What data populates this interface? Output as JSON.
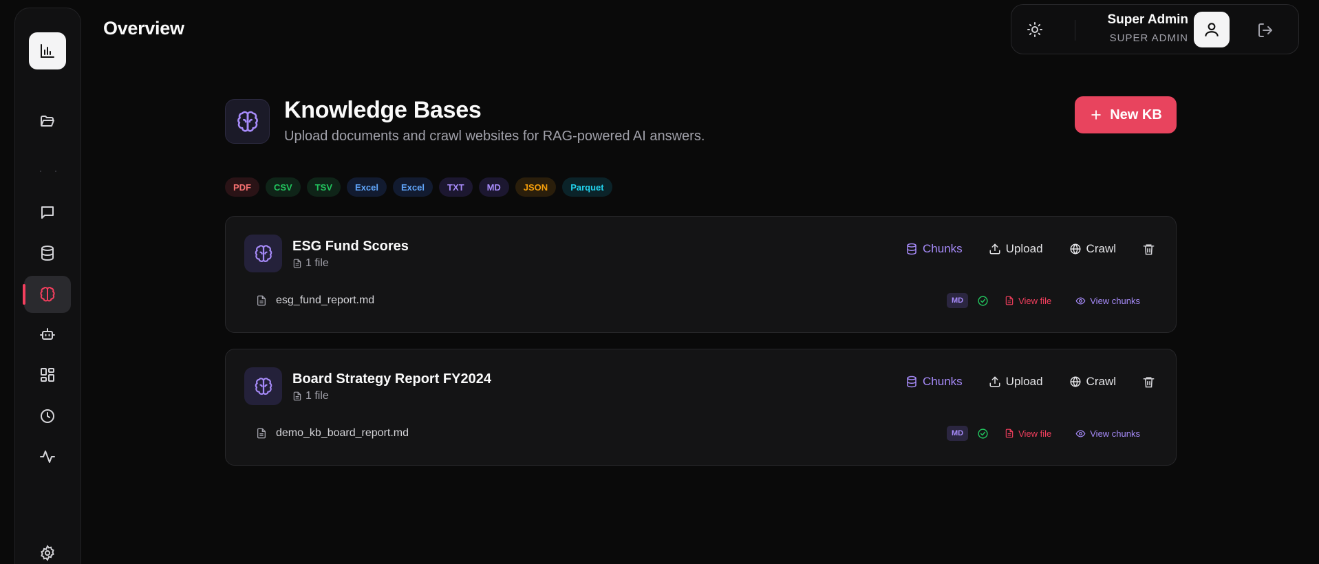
{
  "header": {
    "title": "Overview"
  },
  "user": {
    "name": "Super Admin",
    "role": "SUPER ADMIN"
  },
  "sidebar": {
    "items": [
      {
        "icon": "bar-chart-icon"
      },
      {
        "icon": "folder-open-icon"
      },
      {
        "icon": "message-square-icon"
      },
      {
        "icon": "database-icon"
      },
      {
        "icon": "brain-icon",
        "active": true
      },
      {
        "icon": "bot-icon"
      },
      {
        "icon": "layout-grid-icon"
      },
      {
        "icon": "clock-icon"
      },
      {
        "icon": "activity-icon"
      },
      {
        "icon": "settings-icon"
      }
    ]
  },
  "section": {
    "title": "Knowledge Bases",
    "subtitle": "Upload documents and crawl websites for RAG-powered AI answers.",
    "new_button": "New KB"
  },
  "formats": [
    {
      "label": "PDF",
      "color": "#f87171",
      "bg": "#2a1316"
    },
    {
      "label": "CSV",
      "color": "#22c55e",
      "bg": "#0f2418"
    },
    {
      "label": "TSV",
      "color": "#22c55e",
      "bg": "#0f2418"
    },
    {
      "label": "Excel",
      "color": "#60a5fa",
      "bg": "#121b30"
    },
    {
      "label": "Excel",
      "color": "#60a5fa",
      "bg": "#121b30"
    },
    {
      "label": "TXT",
      "color": "#a78bfa",
      "bg": "#1c1730"
    },
    {
      "label": "MD",
      "color": "#a78bfa",
      "bg": "#1c1730"
    },
    {
      "label": "JSON",
      "color": "#f59e0b",
      "bg": "#2a1e0b"
    },
    {
      "label": "Parquet",
      "color": "#22d3ee",
      "bg": "#0b2329"
    }
  ],
  "actions": {
    "chunks": "Chunks",
    "upload": "Upload",
    "crawl": "Crawl",
    "view_file": "View file",
    "view_chunks": "View chunks"
  },
  "knowledge_bases": [
    {
      "name": "ESG Fund Scores",
      "file_count": "1 file",
      "files": [
        {
          "name": "esg_fund_report.md",
          "type": "MD"
        }
      ]
    },
    {
      "name": "Board Strategy Report FY2024",
      "file_count": "1 file",
      "files": [
        {
          "name": "demo_kb_board_report.md",
          "type": "MD"
        }
      ]
    }
  ],
  "colors": {
    "accent": "#e8445e",
    "brand_purple": "#a78bfa",
    "success": "#22c55e"
  }
}
